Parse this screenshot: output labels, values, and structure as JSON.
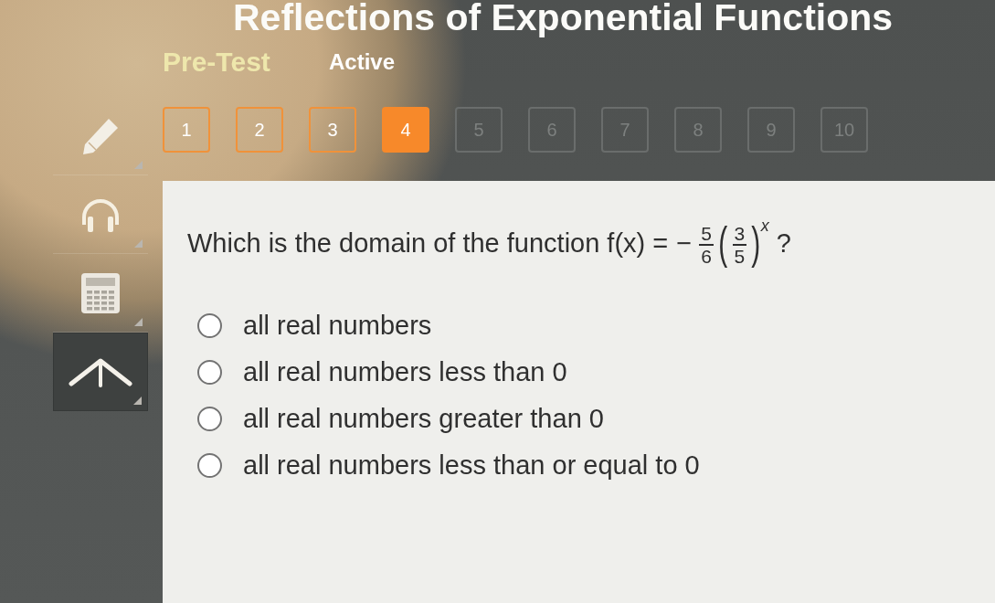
{
  "lesson": {
    "title": "Reflections of Exponential Functions",
    "section": "Pre-Test",
    "status": "Active"
  },
  "tools": [
    {
      "kind": "pencil",
      "selected": false
    },
    {
      "kind": "headphones",
      "selected": false
    },
    {
      "kind": "calculator",
      "selected": false
    },
    {
      "kind": "pointer",
      "selected": true
    }
  ],
  "questions": [
    {
      "label": "1",
      "selected": false,
      "visited": true
    },
    {
      "label": "2",
      "selected": false,
      "visited": true
    },
    {
      "label": "3",
      "selected": false,
      "visited": true
    },
    {
      "label": "4",
      "selected": true,
      "visited": true
    },
    {
      "label": "5",
      "selected": false,
      "visited": false
    },
    {
      "label": "6",
      "selected": false,
      "visited": false
    },
    {
      "label": "7",
      "selected": false,
      "visited": false
    },
    {
      "label": "8",
      "selected": false,
      "visited": false
    },
    {
      "label": "9",
      "selected": false,
      "visited": false
    },
    {
      "label": "10",
      "selected": false,
      "visited": false
    }
  ],
  "question": {
    "text": "Which is the domain of the function",
    "formula": [
      {
        "kind": "text",
        "text": "f(x) ="
      },
      {
        "kind": "text",
        "text": "−"
      },
      {
        "kind": "fraction",
        "numerator": "5",
        "denominator": "6"
      },
      {
        "kind": "paren",
        "text": "("
      },
      {
        "kind": "fraction",
        "numerator": "3",
        "denominator": "5"
      },
      {
        "kind": "paren",
        "text": ")"
      },
      {
        "kind": "superscript",
        "text": "x"
      },
      {
        "kind": "text",
        "text": "?"
      }
    ]
  },
  "options": [
    {
      "text": "all real numbers",
      "selected": false
    },
    {
      "text": "all real numbers less than 0",
      "selected": false
    },
    {
      "text": "all real numbers greater than 0",
      "selected": false
    },
    {
      "text": "all real numbers less than or equal to 0",
      "selected": false
    }
  ]
}
